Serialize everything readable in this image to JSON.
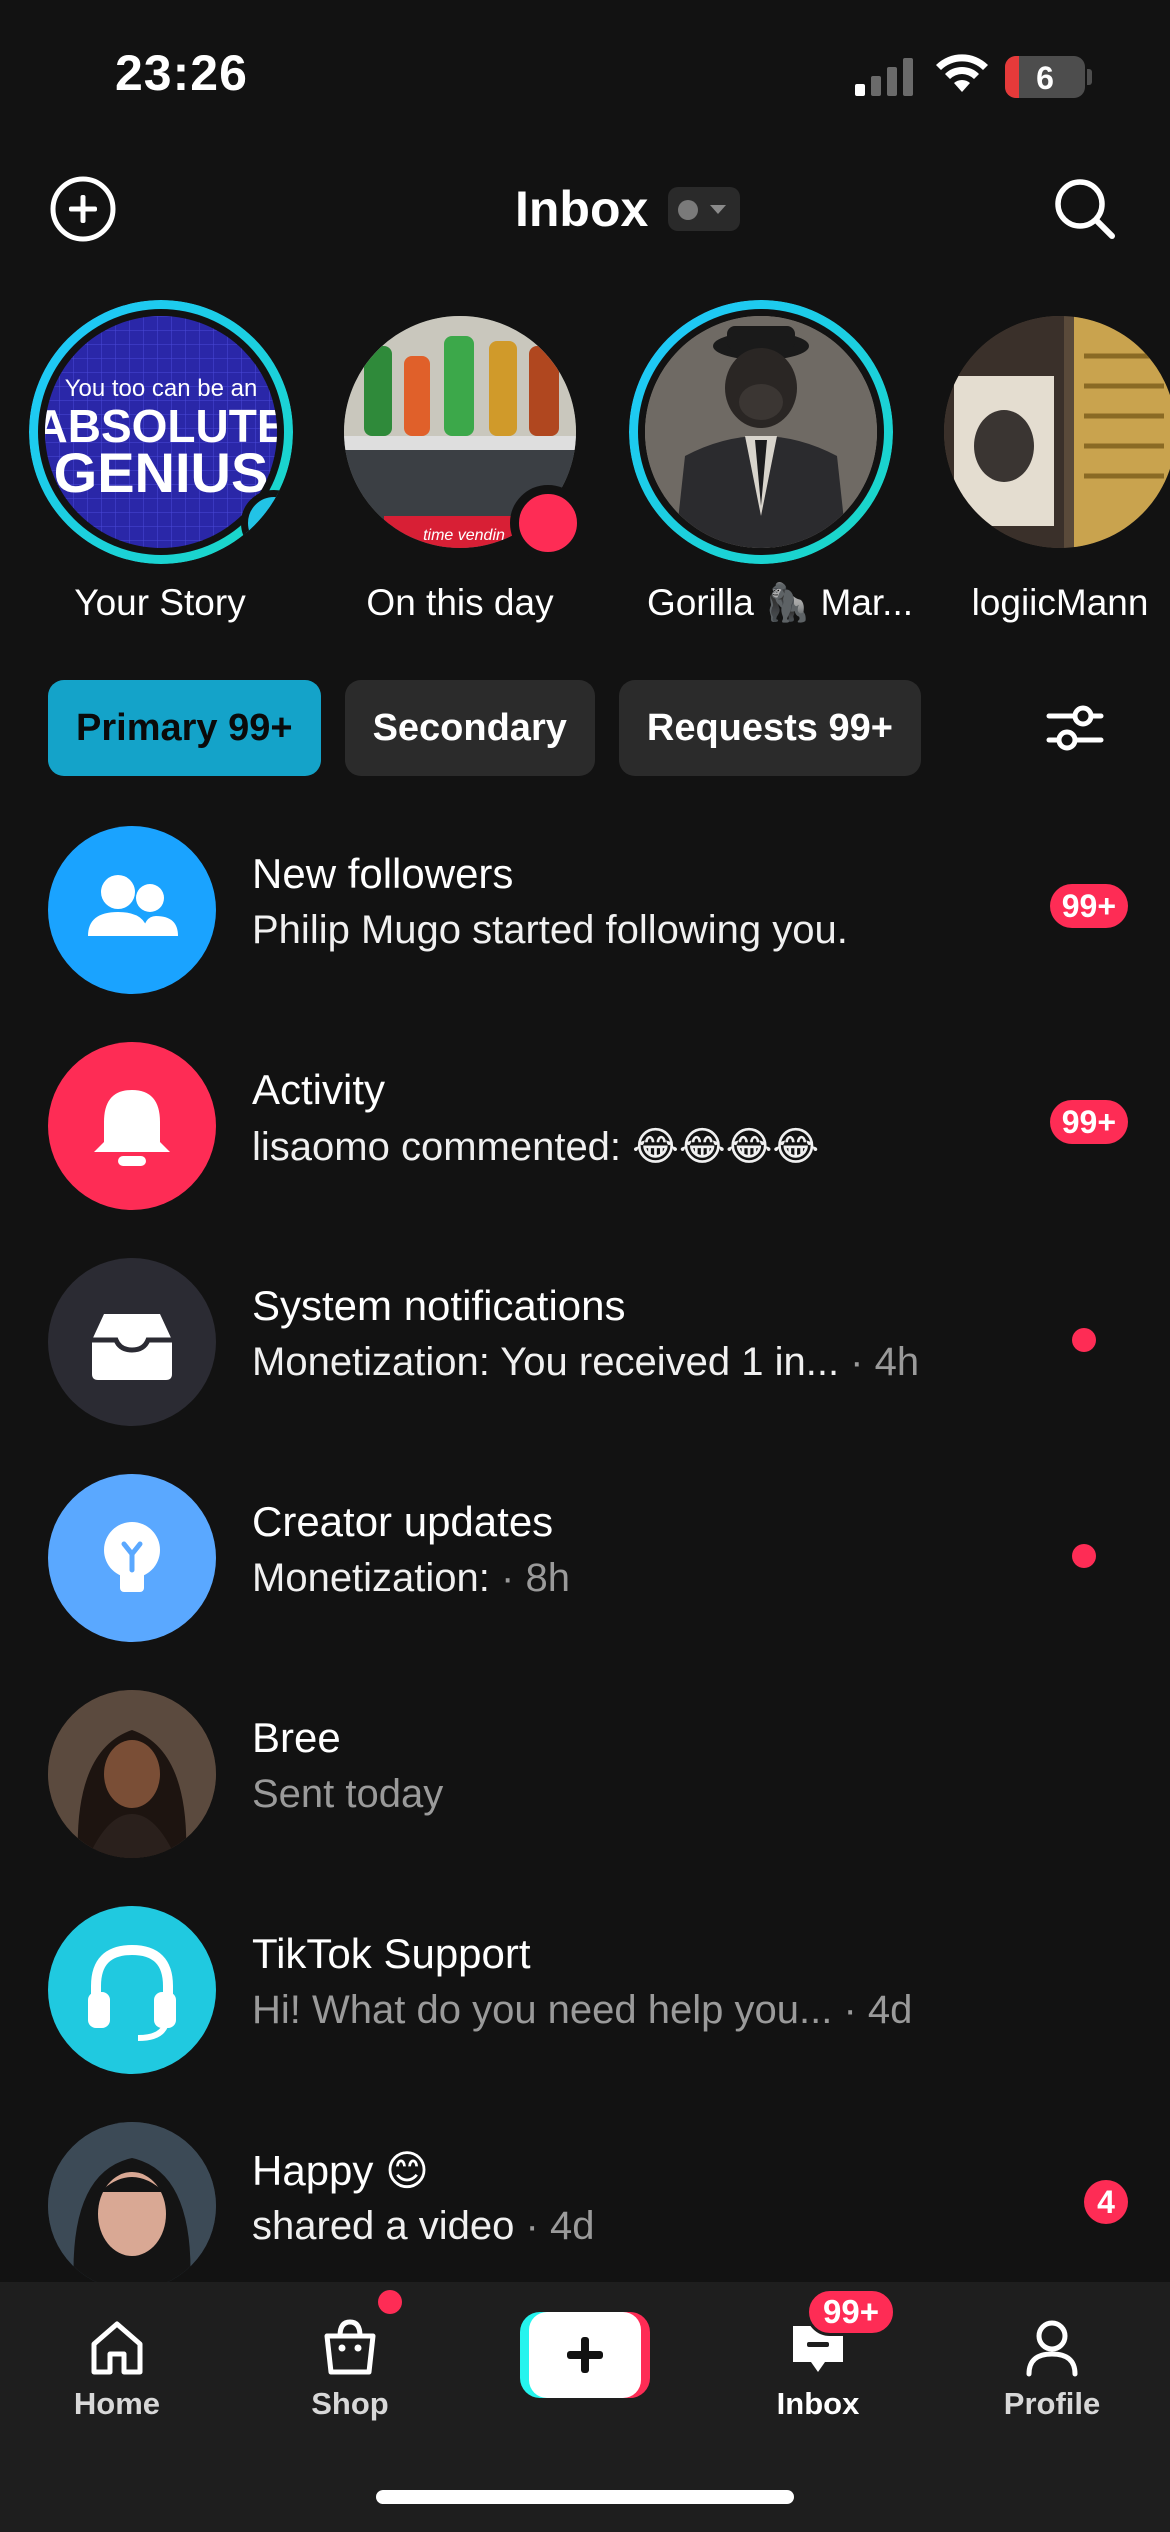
{
  "status_bar": {
    "time": "23:26",
    "battery": "6"
  },
  "header": {
    "title": "Inbox"
  },
  "stories": [
    {
      "label": "Your Story"
    },
    {
      "label": "On this day"
    },
    {
      "label": "Gorilla 🦍 Mar..."
    },
    {
      "label": "logiicMann"
    }
  ],
  "story_art": {
    "line1": "You too can be an",
    "line2": "ABSOLUTE",
    "line3": "GENIUS",
    "vending": "time vendin"
  },
  "tabs": [
    {
      "label": "Primary 99+",
      "active": true
    },
    {
      "label": "Secondary",
      "active": false
    },
    {
      "label": "Requests 99+",
      "active": false
    }
  ],
  "inbox": [
    {
      "title": "New followers",
      "subtitle": "Philip Mugo started following you.",
      "time": "",
      "badge": "99+",
      "icon": "followers-icon",
      "color": "#1aa3ff"
    },
    {
      "title": "Activity",
      "subtitle": "lisaomo commented: 😂😂😂😂",
      "time": "",
      "badge": "99+",
      "icon": "bell-icon",
      "color": "#fe2c55"
    },
    {
      "title": "System notifications",
      "subtitle": "Monetization: You received 1 in...",
      "time": " · 4h",
      "badge": "",
      "icon": "inbox-tray-icon",
      "color": "#2b2b33"
    },
    {
      "title": "Creator updates",
      "subtitle": "Monetization: ",
      "time": " · 8h",
      "badge": "",
      "icon": "lightbulb-icon",
      "color": "#5aa8ff"
    },
    {
      "title": "Bree",
      "subtitle": "Sent today",
      "time": "",
      "badge": "",
      "icon": "avatar",
      "color": "#3a2a22"
    },
    {
      "title": "TikTok Support",
      "subtitle": "Hi! What do you need help you...",
      "time": "  · 4d",
      "badge": "",
      "icon": "headset-icon",
      "color": "#20c9e0"
    },
    {
      "title": "Happy 😊",
      "subtitle": "shared a video",
      "time": " · 4d",
      "badge": "4",
      "icon": "avatar",
      "color": "#2a3440"
    }
  ],
  "bottom_nav": {
    "home": "Home",
    "shop": "Shop",
    "inbox": "Inbox",
    "inbox_badge": "99+",
    "profile": "Profile"
  }
}
